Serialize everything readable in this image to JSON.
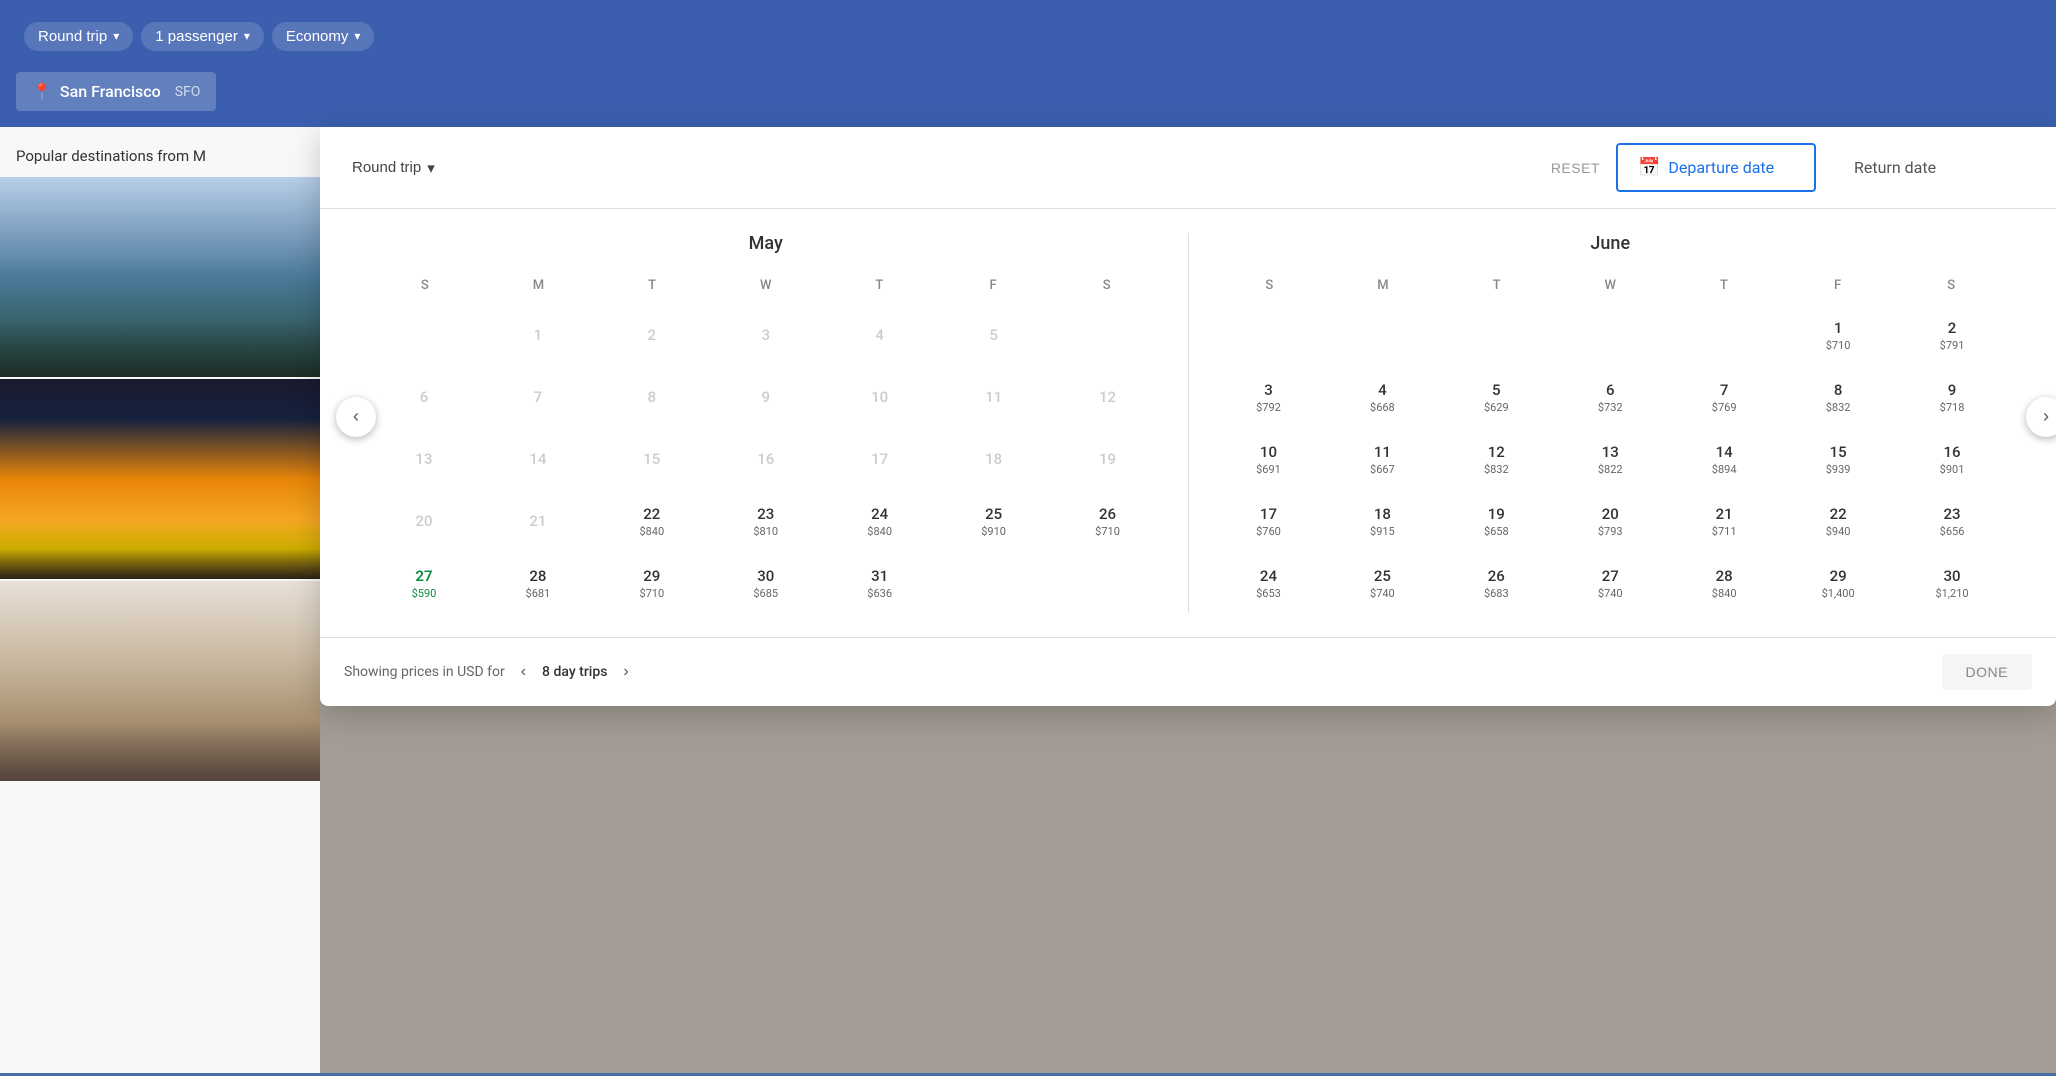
{
  "topBar": {
    "roundTrip": "Round trip",
    "passengers": "1 passenger",
    "cabinClass": "Economy",
    "chevron": "▾"
  },
  "searchBar": {
    "locationIcon": "📍",
    "city": "San Francisco",
    "code": "SFO"
  },
  "leftPanel": {
    "popularTitle": "Popular destinations from M"
  },
  "calendar": {
    "tripTypeLabel": "Round trip",
    "chevron": "▾",
    "resetLabel": "RESET",
    "departureDateLabel": "Departure date",
    "returnDateLabel": "Return date",
    "calendarIcon": "📅",
    "months": [
      {
        "name": "May",
        "dayHeaders": [
          "S",
          "M",
          "T",
          "W",
          "T",
          "F",
          "S"
        ],
        "startDay": 2,
        "weeks": [
          [
            null,
            1,
            2,
            3,
            4,
            5,
            null
          ],
          [
            6,
            7,
            8,
            9,
            10,
            11,
            12
          ],
          [
            13,
            14,
            15,
            16,
            17,
            18,
            19
          ],
          [
            20,
            21,
            22,
            23,
            24,
            25,
            26
          ],
          [
            27,
            28,
            29,
            30,
            31,
            null,
            null
          ]
        ],
        "prices": {
          "22": "$840",
          "23": "$810",
          "24": "$840",
          "25": "$910",
          "26": "$710",
          "27": "$590",
          "28": "$681",
          "29": "$710",
          "30": "$685",
          "31": "$636"
        },
        "highlighted": [
          27
        ],
        "past": [
          1,
          2,
          3,
          4,
          5,
          6,
          7,
          8,
          9,
          10,
          11,
          12,
          13,
          14,
          15,
          16,
          17,
          18,
          19,
          20,
          21
        ]
      },
      {
        "name": "June",
        "dayHeaders": [
          "S",
          "M",
          "T",
          "W",
          "T",
          "F",
          "S"
        ],
        "startDay": 6,
        "weeks": [
          [
            null,
            null,
            null,
            null,
            null,
            1,
            2
          ],
          [
            3,
            4,
            5,
            6,
            7,
            8,
            9
          ],
          [
            10,
            11,
            12,
            13,
            14,
            15,
            16
          ],
          [
            17,
            18,
            19,
            20,
            21,
            22,
            23
          ],
          [
            24,
            25,
            26,
            27,
            28,
            29,
            30
          ]
        ],
        "prices": {
          "1": "$710",
          "2": "$791",
          "3": "$792",
          "4": "$668",
          "5": "$629",
          "6": "$732",
          "7": "$769",
          "8": "$832",
          "9": "$718",
          "10": "$691",
          "11": "$667",
          "12": "$832",
          "13": "$822",
          "14": "$894",
          "15": "$939",
          "16": "$901",
          "17": "$760",
          "18": "$915",
          "19": "$658",
          "20": "$793",
          "21": "$711",
          "22": "$940",
          "23": "$656",
          "24": "$653",
          "25": "$740",
          "26": "$683",
          "27": "$740",
          "28": "$840",
          "29": "$1,400",
          "30": "$1,210"
        },
        "highlighted": [],
        "past": []
      }
    ],
    "footer": {
      "showingText": "Showing prices in USD for",
      "prevArrow": "‹",
      "tripDaysLabel": "8 day trips",
      "nextArrow": "›",
      "doneLabel": "DONE"
    }
  }
}
